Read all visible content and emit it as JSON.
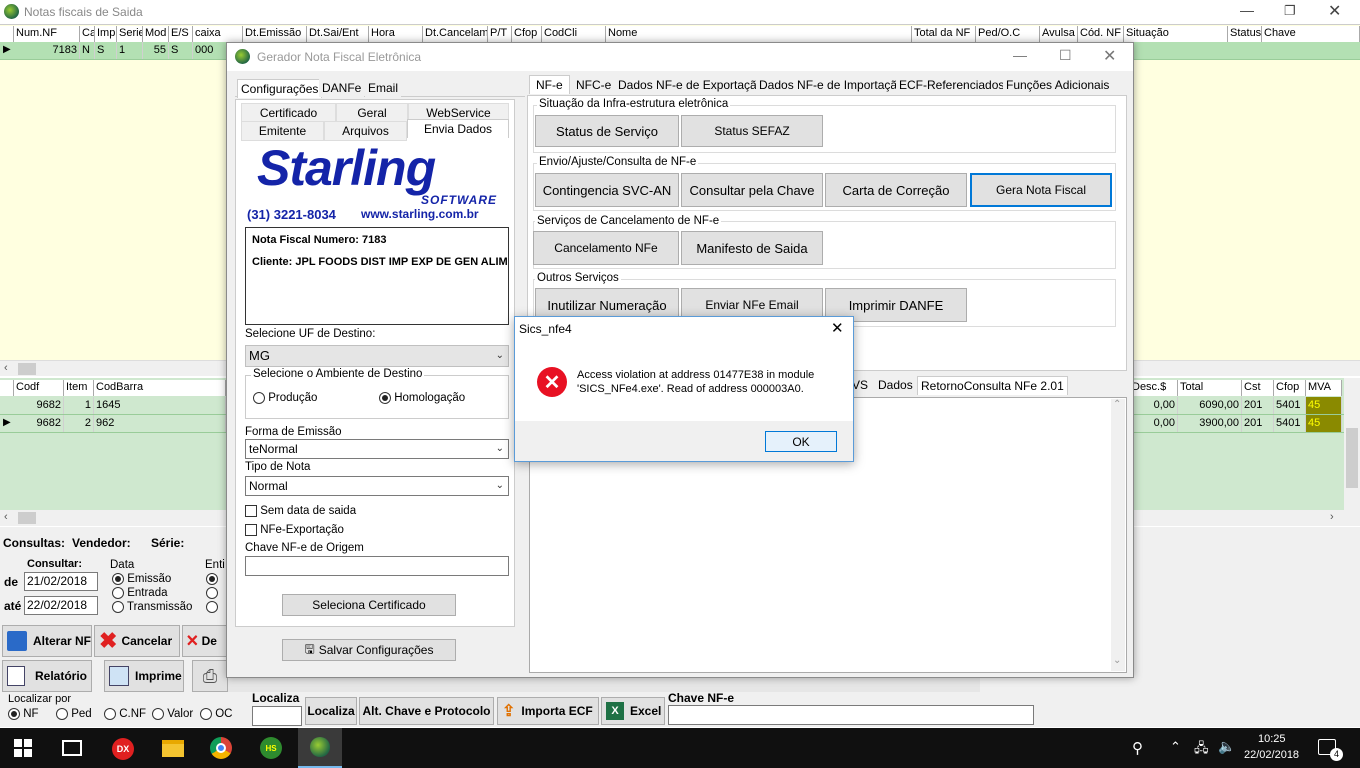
{
  "main_window": {
    "title": "Notas fiscais de Saida",
    "columns": [
      "Num.NF",
      "Ca",
      "Imp",
      "Serie",
      "Mod",
      "E/S",
      "caixa",
      "Dt.Emissão",
      "Dt.Sai/Ent",
      "Hora",
      "Dt.Cancelam",
      "P/T",
      "Cfop",
      "CodCli",
      "Nome",
      "Total da NF",
      "Ped/O.C",
      "Avulsa",
      "Cód. NF",
      "Situação",
      "Status",
      "Chave"
    ],
    "row": [
      "7183",
      "N",
      "S",
      "1",
      "55",
      "S",
      "000"
    ],
    "items_columns": [
      "Codf",
      "Item",
      "CodBarra"
    ],
    "items_columns_right": [
      "Desc.$",
      "Total",
      "Cst",
      "Cfop",
      "MVA"
    ],
    "items": [
      {
        "codf": "9682",
        "item": "1",
        "codbarra": "1645",
        "desc": "0,00",
        "total": "6090,00",
        "cst": "201",
        "cfop": "5401",
        "mva": "45"
      },
      {
        "codf": "9682",
        "item": "2",
        "codbarra": "962",
        "desc": "0,00",
        "total": "3900,00",
        "cst": "201",
        "cfop": "5401",
        "mva": "45"
      }
    ],
    "consultas_label": "Consultas:",
    "vendedor_label": "Vendedor:",
    "serie_label": "Série:",
    "consultar_label": "Consultar:",
    "de_label": "de",
    "ate_label": "até",
    "date_from": "21/02/2018",
    "date_to": "22/02/2018",
    "data_label": "Data",
    "data_options": [
      "Emissão",
      "Entrada",
      "Transmissão"
    ],
    "entidade_label": "Enti",
    "buttons_row1": [
      "Alterar NF",
      "Cancelar",
      "De"
    ],
    "buttons_row2": [
      "Relatório",
      "Imprime"
    ],
    "localizar_por_label": "Localizar por",
    "localizar_options": [
      "NF",
      "Ped",
      "C.NF",
      "Valor",
      "OC"
    ],
    "localiza_label": "Localiza",
    "bottom_buttons": [
      "Localiza",
      "Alt. Chave e Protocolo",
      "Importa ECF",
      "Excel"
    ],
    "chave_nfe_label": "Chave NF-e"
  },
  "gerador": {
    "title": "Gerador Nota Fiscal Eletrônica",
    "left_tabs": [
      "Configurações",
      "DANFe",
      "Email"
    ],
    "sub_tabs_row1": [
      "Certificado",
      "Geral",
      "WebService"
    ],
    "sub_tabs_row2": [
      "Emitente",
      "Arquivos",
      "Envia Dados"
    ],
    "logo_text": "Starling",
    "logo_sub": "SOFTWARE",
    "logo_phone": "(31) 3221-8034",
    "logo_site": "www.starling.com.br",
    "info_numero": "Nota Fiscal Numero: 7183",
    "info_cliente": "Cliente: JPL FOODS DIST IMP EXP DE GEN ALIM",
    "uf_label": "Selecione UF de Destino:",
    "uf_value": "MG",
    "ambiente_label": "Selecione o Ambiente de Destino",
    "ambiente_options": [
      "Produção",
      "Homologação"
    ],
    "forma_label": "Forma de Emissão",
    "forma_value": "teNormal",
    "tipo_label": "Tipo de Nota",
    "tipo_value": "Normal",
    "sem_data_label": "Sem data de saida",
    "nfe_export_label": "NFe-Exportação",
    "chave_origem_label": "Chave NF-e de Origem",
    "seleciona_cert": "Seleciona Certificado",
    "salvar_config": "Salvar Configurações",
    "right_tabs": [
      "NF-e",
      "NFC-e",
      "Dados NF-e de Exportação",
      "Dados NF-e de Importação",
      "ECF-Referenciados:",
      "Funções Adicionais"
    ],
    "grp1_title": "Situação da Infra-estrutura eletrônica",
    "grp1_buttons": [
      "Status de Serviço",
      "Status SEFAZ"
    ],
    "grp2_title": "Envio/Ajuste/Consulta de NF-e",
    "grp2_buttons": [
      "Contingencia SVC-AN",
      "Consultar pela Chave",
      "Carta de Correção",
      "Gera Nota Fiscal"
    ],
    "grp3_title": "Serviços de Cancelamento de NF-e",
    "grp3_buttons": [
      "Cancelamento NFe",
      "Manifesto de Saida"
    ],
    "grp4_title": "Outros Serviços",
    "grp4_buttons": [
      "Inutilizar Numeração",
      "Enviar NFe Email",
      "Imprimir DANFE"
    ],
    "bottom_tabs": [
      "VS",
      "Dados",
      "RetornoConsulta NFe 2.01"
    ]
  },
  "dialog": {
    "title": "Sics_nfe4",
    "message_line1": "Access violation at address 01477E38 in module",
    "message_line2": "'SICS_NFe4.exe'. Read of address 000003A0.",
    "ok_label": "OK"
  },
  "taskbar": {
    "time": "10:25",
    "date": "22/02/2018",
    "notifications": "4"
  },
  "colors": {
    "title_bar": "#ffffff",
    "grid_yellow": "#ffffe0",
    "grid_green": "#cfe8cf",
    "row_selected": "#b3e0b3",
    "accent_blue": "#0078d7",
    "taskbar": "#101010",
    "error_red": "#e81123"
  }
}
